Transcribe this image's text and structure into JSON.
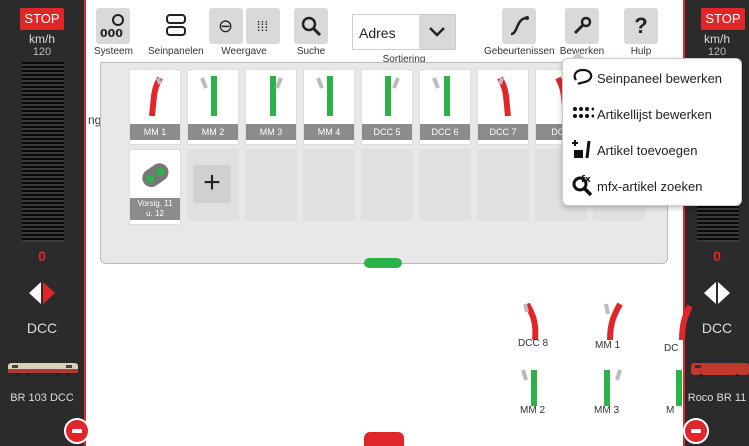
{
  "left_throttle": {
    "stop": "STOP",
    "unit": "km/h",
    "max_speed": "120",
    "speed": "0",
    "protocol": "DCC",
    "loco_name": "BR 103 DCC"
  },
  "right_throttle": {
    "stop": "STOP",
    "unit": "km/h",
    "max_speed": "120",
    "speed": "0",
    "protocol": "DCC",
    "loco_name": "Roco BR 11"
  },
  "toolbar": {
    "system": "Systeem",
    "seinpanelen": "Seinpanelen",
    "weergave": "Weergave",
    "zoeken": "Suche",
    "sort_value": "Adres",
    "sort_label": "Sortiering",
    "gebeurtenissen": "Gebeurtenissen",
    "bewerken": "Bewerken",
    "help": "Hulp"
  },
  "panel": {
    "cut_text": "ng",
    "tiles": [
      "MM 1",
      "MM 2",
      "MM 3",
      "MM 4",
      "DCC 5",
      "DCC 6",
      "DCC 7",
      "DCC"
    ],
    "signal_line1": "Vorsig. 11",
    "signal_line2": "u. 12"
  },
  "menu": {
    "items": [
      "Seinpaneel bewerken",
      "Artikellijst bewerken",
      "Artikel toevoegen",
      "mfx-artikel zoeken"
    ]
  },
  "layout_labels": [
    "DCC 8",
    "MM 1",
    "DC",
    "MM 2",
    "MM 3",
    "M"
  ],
  "colors": {
    "red": "#e1262b",
    "green": "#2bb34a",
    "dark": "#2b2b2b"
  }
}
